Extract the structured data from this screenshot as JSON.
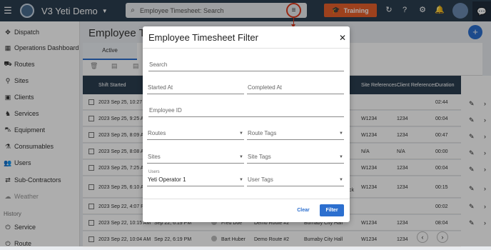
{
  "app": {
    "title": "V3 Yeti Demo"
  },
  "topbar": {
    "search_text": "Employee Timesheet: Search",
    "training_label": "Training"
  },
  "sidebar": {
    "items": [
      {
        "label": "Dispatch"
      },
      {
        "label": "Operations Dashboard"
      },
      {
        "label": "Routes"
      },
      {
        "label": "Sites"
      },
      {
        "label": "Clients"
      },
      {
        "label": "Services"
      },
      {
        "label": "Equipment"
      },
      {
        "label": "Consumables"
      },
      {
        "label": "Users"
      },
      {
        "label": "Sub-Contractors"
      },
      {
        "label": "Weather"
      }
    ],
    "history_label": "History",
    "history_items": [
      {
        "label": "Service"
      },
      {
        "label": "Route"
      }
    ]
  },
  "main": {
    "page_title": "Employee Tim",
    "tab_active": "Active",
    "columns": {
      "shift_started": "Shift Started",
      "site_refs": "Site References",
      "client_refs": "Client References",
      "duration": "Duration"
    },
    "rows": [
      {
        "shift": "2023 Sep 25, 10:27 ...",
        "col2": "",
        "user": "",
        "route": "",
        "site": "",
        "site_ref": "",
        "client_ref": "",
        "duration": "02:44"
      },
      {
        "shift": "2023 Sep 25, 9:25 A",
        "col2": "",
        "user": "",
        "route": "",
        "site": "",
        "site_ref": "W1234",
        "client_ref": "1234",
        "duration": "00:04"
      },
      {
        "shift": "2023 Sep 25, 8:09 A",
        "col2": "",
        "user": "",
        "route": "",
        "site": "",
        "site_ref": "W1234",
        "client_ref": "1234",
        "duration": "00:47"
      },
      {
        "shift": "2023 Sep 25, 8:08 A",
        "col2": "",
        "user": "",
        "route": "",
        "site": "",
        "site_ref": "N/A",
        "client_ref": "N/A",
        "duration": "00:00"
      },
      {
        "shift": "2023 Sep 25, 7:25 A",
        "col2": "",
        "user": "",
        "route": "",
        "site": "",
        "site_ref": "W1234",
        "client_ref": "1234",
        "duration": "00:04"
      },
      {
        "shift": "2023 Sep 25, 6:10 A",
        "col2": "",
        "user": "",
        "route": "",
        "site": "ck",
        "site_ref": "W1234",
        "client_ref": "1234",
        "duration": "00:15"
      },
      {
        "shift": "2023 Sep 22, 4:07 P",
        "col2": "",
        "user": "",
        "route": "",
        "site": "",
        "site_ref": "",
        "client_ref": "",
        "duration": "00:02"
      },
      {
        "shift": "2023 Sep 22, 10:15 AM",
        "col2": "Sep 22, 6:19 PM",
        "user": "Fred Doe",
        "route": "Demo Route #2",
        "site": "Burnaby City Hall",
        "site_ref": "W1234",
        "client_ref": "1234",
        "duration": "08:04"
      },
      {
        "shift": "2023 Sep 22, 10:04 AM",
        "col2": "Sep 22, 6:19 PM",
        "user": "Bart Huber",
        "route": "Demo Route #2",
        "site": "Burnaby City Hall",
        "site_ref": "W1234",
        "client_ref": "1234",
        "duration": ""
      }
    ]
  },
  "modal": {
    "title": "Employee Timesheet Filter",
    "search_label": "Search",
    "started_at_label": "Started At",
    "completed_at_label": "Completed At",
    "employee_id_label": "Employee ID",
    "routes_label": "Routes",
    "route_tags_label": "Route Tags",
    "sites_label": "Sites",
    "site_tags_label": "Site Tags",
    "users_label": "Users",
    "users_value": "Yeti Operator 1",
    "user_tags_label": "User Tags",
    "clear_label": "Clear",
    "filter_label": "Filter"
  },
  "colors": {
    "accent": "#2c6fcf",
    "topbar": "#2c3e50",
    "training": "#e8612c",
    "highlight": "#e03a1d"
  }
}
